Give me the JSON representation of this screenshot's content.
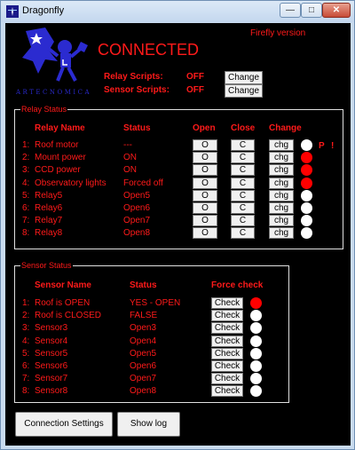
{
  "window": {
    "title": "Dragonfly",
    "controls": {
      "minimize": "—",
      "maximize": "□",
      "close": "✕"
    }
  },
  "logo": {
    "text": "ARTECNOMICA"
  },
  "status": {
    "connection": "CONNECTED",
    "version": "Firefly version"
  },
  "scripts": [
    {
      "label": "Relay Scripts:",
      "state": "OFF",
      "button": "Change"
    },
    {
      "label": "Sensor Scripts:",
      "state": "OFF",
      "button": "Change"
    }
  ],
  "relay_group": {
    "title": "Relay Status",
    "headers": {
      "name": "Relay Name",
      "status": "Status",
      "open": "Open",
      "close": "Close",
      "change": "Change"
    },
    "flags": [
      "P",
      "!"
    ],
    "rows": [
      {
        "num": "1:",
        "name": "Roof motor",
        "status": "---",
        "open": "O",
        "close": "C",
        "change": "chg",
        "led": "#ffffff"
      },
      {
        "num": "2:",
        "name": "Mount power",
        "status": "ON",
        "open": "O",
        "close": "C",
        "change": "chg",
        "led": "#ff0000"
      },
      {
        "num": "3:",
        "name": "CCD power",
        "status": "ON",
        "open": "O",
        "close": "C",
        "change": "chg",
        "led": "#ff0000"
      },
      {
        "num": "4:",
        "name": "Observatory lights",
        "status": "Forced off",
        "open": "O",
        "close": "C",
        "change": "chg",
        "led": "#ff0000"
      },
      {
        "num": "5:",
        "name": "Relay5",
        "status": "Open5",
        "open": "O",
        "close": "C",
        "change": "chg",
        "led": "#ffffff"
      },
      {
        "num": "6:",
        "name": "Relay6",
        "status": "Open6",
        "open": "O",
        "close": "C",
        "change": "chg",
        "led": "#ffffff"
      },
      {
        "num": "7:",
        "name": "Relay7",
        "status": "Open7",
        "open": "O",
        "close": "C",
        "change": "chg",
        "led": "#ffffff"
      },
      {
        "num": "8:",
        "name": "Relay8",
        "status": "Open8",
        "open": "O",
        "close": "C",
        "change": "chg",
        "led": "#ffffff"
      }
    ]
  },
  "sensor_group": {
    "title": "Sensor Status",
    "headers": {
      "name": "Sensor Name",
      "status": "Status",
      "check": "Force check"
    },
    "rows": [
      {
        "num": "1:",
        "name": "Roof is OPEN",
        "status": "YES - OPEN",
        "check": "Check",
        "led": "#ff0000"
      },
      {
        "num": "2:",
        "name": "Roof is CLOSED",
        "status": "FALSE",
        "check": "Check",
        "led": "#ffffff"
      },
      {
        "num": "3:",
        "name": "Sensor3",
        "status": "Open3",
        "check": "Check",
        "led": "#ffffff"
      },
      {
        "num": "4:",
        "name": "Sensor4",
        "status": "Open4",
        "check": "Check",
        "led": "#ffffff"
      },
      {
        "num": "5:",
        "name": "Sensor5",
        "status": "Open5",
        "check": "Check",
        "led": "#ffffff"
      },
      {
        "num": "6:",
        "name": "Sensor6",
        "status": "Open6",
        "check": "Check",
        "led": "#ffffff"
      },
      {
        "num": "7:",
        "name": "Sensor7",
        "status": "Open7",
        "check": "Check",
        "led": "#ffffff"
      },
      {
        "num": "8:",
        "name": "Sensor8",
        "status": "Open8",
        "check": "Check",
        "led": "#ffffff"
      }
    ]
  },
  "footer": {
    "connection_settings": "Connection Settings",
    "show_log": "Show log"
  },
  "colors": {
    "accent": "#ff1a1a",
    "background": "#000000",
    "led_on": "#ff0000",
    "led_off": "#ffffff"
  }
}
